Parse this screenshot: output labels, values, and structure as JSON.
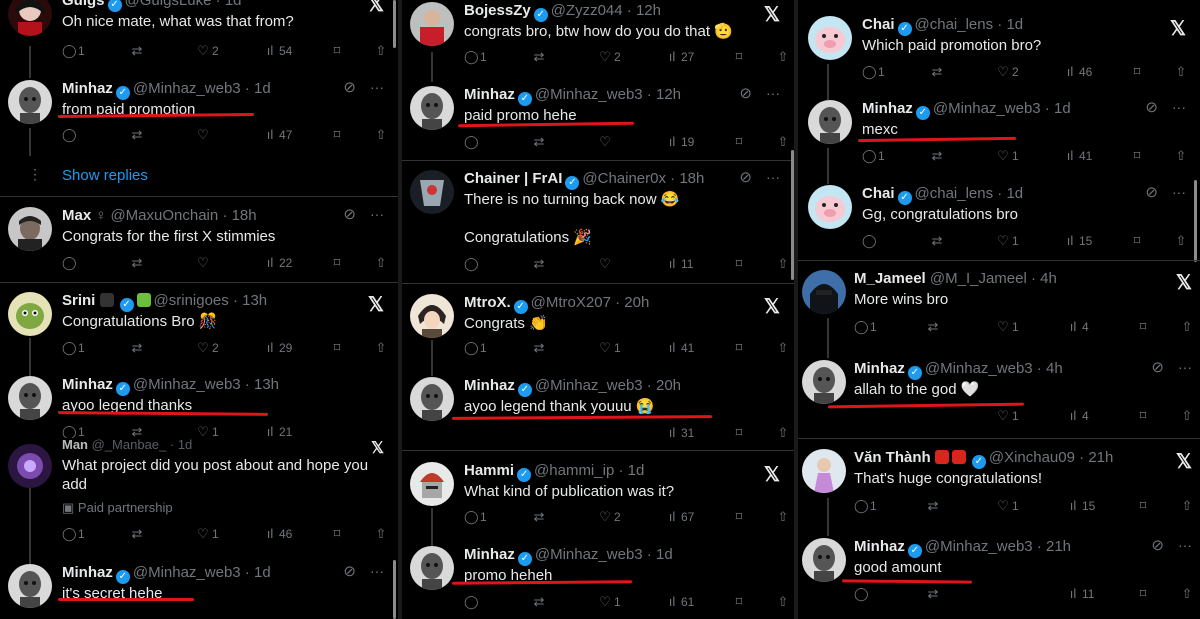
{
  "col1": {
    "guigs": {
      "name": "Guigs",
      "handle": "@GuigsLuke",
      "time": "1d",
      "text": "Oh nice mate, what was that from?",
      "replies": "1",
      "likes": "2",
      "views": "54"
    },
    "minhaz1": {
      "name": "Minhaz",
      "handle": "@Minhaz_web3",
      "time": "1d",
      "text": "from paid promotion",
      "views": "47"
    },
    "show_replies": "Show replies",
    "max": {
      "name": "Max",
      "handle": "@MaxuOnchain",
      "time": "18h",
      "text": "Congrats for the first X stimmies",
      "views": "22"
    },
    "srini": {
      "name": "Srini",
      "handle": "@srinigoes",
      "time": "13h",
      "text": "Congratulations Bro 🎊",
      "replies": "1",
      "likes": "2",
      "views": "29"
    },
    "minhaz2": {
      "name": "Minhaz",
      "handle": "@Minhaz_web3",
      "time": "13h",
      "text": "ayoo legend thanks",
      "replies": "1",
      "likes": "1",
      "views": "21"
    },
    "man": {
      "name": "Man",
      "handle": "@_Manbae_",
      "time": "1d",
      "text": "What project did you post about and hope you\nadd",
      "paid": "Paid partnership",
      "replies": "1",
      "likes": "1",
      "views": "46"
    },
    "minhaz3": {
      "name": "Minhaz",
      "handle": "@Minhaz_web3",
      "time": "1d",
      "text": "it's secret hehe"
    }
  },
  "col2": {
    "bojess": {
      "name": "BojessZy",
      "handle": "@Zyzz044",
      "time": "12h",
      "text": "congrats bro, btw how do you do that 🫡",
      "replies": "1",
      "likes": "2",
      "views": "27"
    },
    "minhaz1": {
      "name": "Minhaz",
      "handle": "@Minhaz_web3",
      "time": "12h",
      "text": "paid promo hehe",
      "views": "19"
    },
    "chainer": {
      "name": "Chainer | FrAI",
      "handle": "@Chainer0x",
      "time": "18h",
      "text": "There is no turning back now 😂\n\nCongratulations 🎉",
      "views": "11"
    },
    "mtrox": {
      "name": "MtroX.",
      "handle": "@MtroX207",
      "time": "20h",
      "text": "Congrats 👏",
      "replies": "1",
      "likes": "1",
      "views": "41"
    },
    "minhaz2": {
      "name": "Minhaz",
      "handle": "@Minhaz_web3",
      "time": "20h",
      "text": "ayoo legend thank youuu 😭",
      "views": "31"
    },
    "hammi": {
      "name": "Hammi",
      "handle": "@hammi_ip",
      "time": "1d",
      "text": "What kind of publication was it?",
      "replies": "1",
      "likes": "2",
      "views": "67"
    },
    "minhaz3": {
      "name": "Minhaz",
      "handle": "@Minhaz_web3",
      "time": "1d",
      "text": "promo heheh",
      "likes": "1",
      "views": "61"
    }
  },
  "col3": {
    "chai1": {
      "name": "Chai",
      "handle": "@chai_lens",
      "time": "1d",
      "text": "Which paid promotion bro?",
      "replies": "1",
      "likes": "2",
      "views": "46"
    },
    "minhaz1": {
      "name": "Minhaz",
      "handle": "@Minhaz_web3",
      "time": "1d",
      "text": "mexc",
      "replies": "1",
      "likes": "1",
      "views": "41"
    },
    "chai2": {
      "name": "Chai",
      "handle": "@chai_lens",
      "time": "1d",
      "text": "Gg, congratulations bro",
      "likes": "1",
      "views": "15"
    },
    "jameel": {
      "name": "M_Jameel",
      "handle": "@M_I_Jameel",
      "time": "4h",
      "text": "More wins bro",
      "replies": "1",
      "likes": "1",
      "views": "4"
    },
    "minhaz2": {
      "name": "Minhaz",
      "handle": "@Minhaz_web3",
      "time": "4h",
      "text": "allah to the god 🤍",
      "likes": "1",
      "views": "4"
    },
    "vanthanh": {
      "name": "Văn Thành",
      "handle": "@Xinchau09",
      "time": "21h",
      "text": "That's huge congratulations!",
      "replies": "1",
      "likes": "1",
      "views": "15"
    },
    "minhaz3": {
      "name": "Minhaz",
      "handle": "@Minhaz_web3",
      "time": "21h",
      "text": "good amount",
      "views": "11"
    }
  },
  "icons": {
    "reply": "reply-icon",
    "repost": "repost-icon",
    "like": "heart-icon",
    "views": "views-icon",
    "bookmark": "bookmark-icon",
    "share": "share-icon",
    "x": "x-logo-icon",
    "more": "more-icon",
    "grok": "grok-icon"
  },
  "glyphs": {
    "x": "𝕏",
    "more": "···",
    "grok": "⊘",
    "reply": "◯",
    "repost": "⇄",
    "like": "♡",
    "views": "ıl",
    "bookmark": "⌑",
    "share": "⇧",
    "verified": "✓",
    "sep": " · "
  },
  "colors": {
    "accent": "#1d9bf0",
    "underline": "#e0151c",
    "bg": "#000000"
  }
}
